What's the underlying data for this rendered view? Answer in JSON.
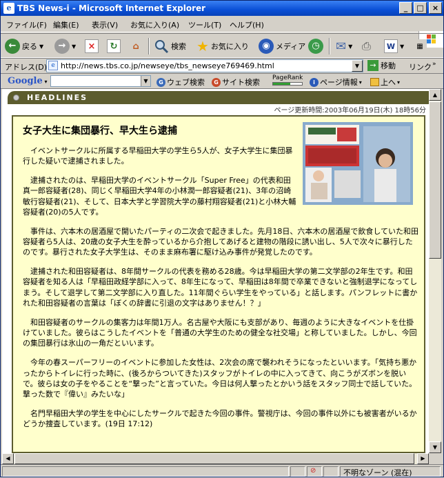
{
  "window": {
    "title": "TBS News-i - Microsoft Internet Explorer"
  },
  "menu": [
    "ファイル(F)",
    "編集(E)",
    "表示(V)",
    "お気に入り(A)",
    "ツール(T)",
    "ヘルプ(H)"
  ],
  "toolbar": {
    "back": "戻る",
    "search": "検索",
    "favorites": "お気に入り",
    "media": "メディア"
  },
  "address": {
    "label": "アドレス(D)",
    "url": "http://news.tbs.co.jp/newseye/tbs_newseye769469.html",
    "go": "移動",
    "links": "リンク"
  },
  "google": {
    "logo": "Google",
    "web_search": "ウェブ検索",
    "site_search": "サイト検索",
    "pagerank": "PageRank",
    "page_info": "ページ情報",
    "up": "上へ"
  },
  "page": {
    "section": "HEADLINES",
    "updated": "ページ更新時間:2003年06月19日(木) 18時56分",
    "headline": "女子大生に集団暴行、早大生ら逮捕",
    "paragraphs": [
      "イベントサークルに所属する早稲田大学の学生ら5人が、女子大学生に集団暴行した疑いで逮捕されました。",
      "逮捕されたのは、早稲田大学のイベントサークル「Super Free」の代表和田真一郎容疑者(28)、同じく早稲田大学4年の小林潤一郎容疑者(21)、3年の沼崎敏行容疑者(21)、そして、日本大学と学習院大学の藤村翔容疑者(21)と小林大輔容疑者(20)の5人です。",
      "事件は、六本木の居酒屋で開いたパーティの二次会で起きました。先月18日、六本木の居酒屋で飲食していた和田容疑者ら5人は、20歳の女子大生を酔っているから介抱してあげると建物の階段に誘い出し、5人で次々に暴行したのです。暴行された女子大学生は、そのまま麻布署に駆け込み事件が発覚したのです。",
      "逮捕された和田容疑者は、8年間サークルの代表を務める28歳。今は早稲田大学の第二文学部の2年生です。和田容疑者を知る人は「早稲田政経学部に入って、8年生になって、早稲田は8年間で卒業できないと強制退学になってしまう。そして退学して第二文学部に入り直した。11年間ぐらい学生をやっている」と話します。パンフレットに書かれた和田容疑者の言葉は「ぼくの辞書に引退の文字はありません！？」",
      "和田容疑者のサークルの集客力は年間1万人。名古屋や大阪にも支部があり、毎週のように大きなイベントを仕掛けていました。彼らはこうしたイベントを「普通の大学生のための健全な社交場」と称していました。しかし、今回の集団暴行は氷山の一角だといいます。",
      "今年の春スーパーフリーのイベントに参加した女性は、2次会の席で襲われそうになったといいます。「気持ち悪かったからトイレに行った時に、(後ろからついてきた)スタッフがトイレの中に入ってきて、向こうがズボンを脱いで。彼らは女の子をやることを“撃った”と言っていた。今日は何人撃ったとかいう話をスタッフ同士で話していた。撃った数で『偉い』みたいな」",
      "名門早稲田大学の学生を中心にしたサークルで起きた今回の事件。警視庁は、今回の事件以外にも被害者がいるかどうか捜査しています。(19日 17:12)"
    ]
  },
  "status": {
    "zone": "不明なゾーン (混在)"
  }
}
